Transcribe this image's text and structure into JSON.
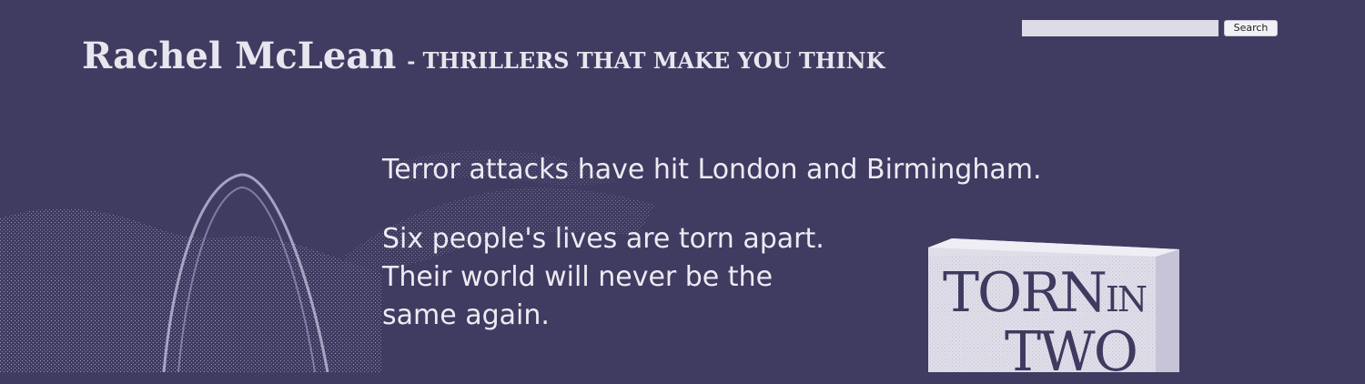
{
  "header": {
    "site_title": "Rachel McLean",
    "separator": "-",
    "tagline": "THRILLERS THAT MAKE YOU THINK"
  },
  "search": {
    "value": "",
    "placeholder": "",
    "button_label": "Search"
  },
  "blurb": {
    "paragraph_1": "Terror attacks have hit London and Birmingham.",
    "paragraph_2_lines": [
      "Six people's lives are torn apart.",
      "Their world will never be the",
      "same again."
    ]
  },
  "book_cover": {
    "title_word_1": "TORN",
    "title_word_2": "IN",
    "title_word_3": "TWO"
  },
  "colors": {
    "background": "#403b61",
    "text": "#ecebf2",
    "cover": "#dedde8"
  }
}
